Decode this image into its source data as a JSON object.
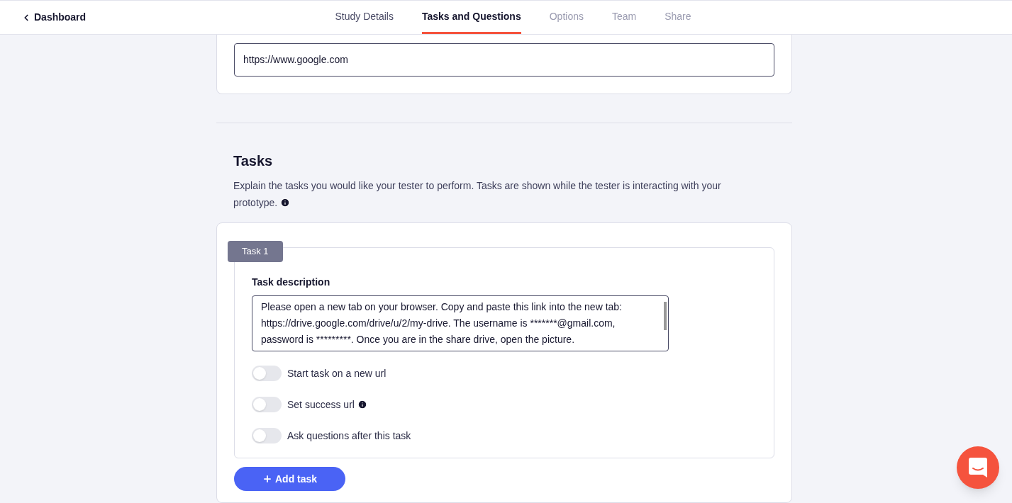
{
  "header": {
    "back": "Dashboard",
    "tabs": [
      {
        "label": "Study Details",
        "selected": false,
        "disabled": false
      },
      {
        "label": "Tasks and Questions",
        "selected": true,
        "disabled": false
      },
      {
        "label": "Options",
        "selected": false,
        "disabled": true
      },
      {
        "label": "Team",
        "selected": false,
        "disabled": true
      },
      {
        "label": "Share",
        "selected": false,
        "disabled": true
      }
    ]
  },
  "url_field": {
    "value": "https://www.google.com"
  },
  "tasks_section": {
    "title": "Tasks",
    "description": "Explain the tasks you would like your tester to perform. Tasks are shown while the tester is interacting with your prototype."
  },
  "tasks": [
    {
      "label": "Task 1",
      "description_label": "Task description",
      "description": "Please open a new tab on your browser. Copy and paste this link into the new tab: https://drive.google.com/drive/u/2/my-drive. The username is *******@gmail.com, password is *********. Once you are in the share drive, open the picture.",
      "toggles": [
        {
          "label": "Start task on a new url",
          "on": false,
          "info": false
        },
        {
          "label": "Set success url",
          "on": false,
          "info": true
        },
        {
          "label": "Ask questions after this task",
          "on": false,
          "info": false
        }
      ]
    }
  ],
  "add_button": "Add task"
}
